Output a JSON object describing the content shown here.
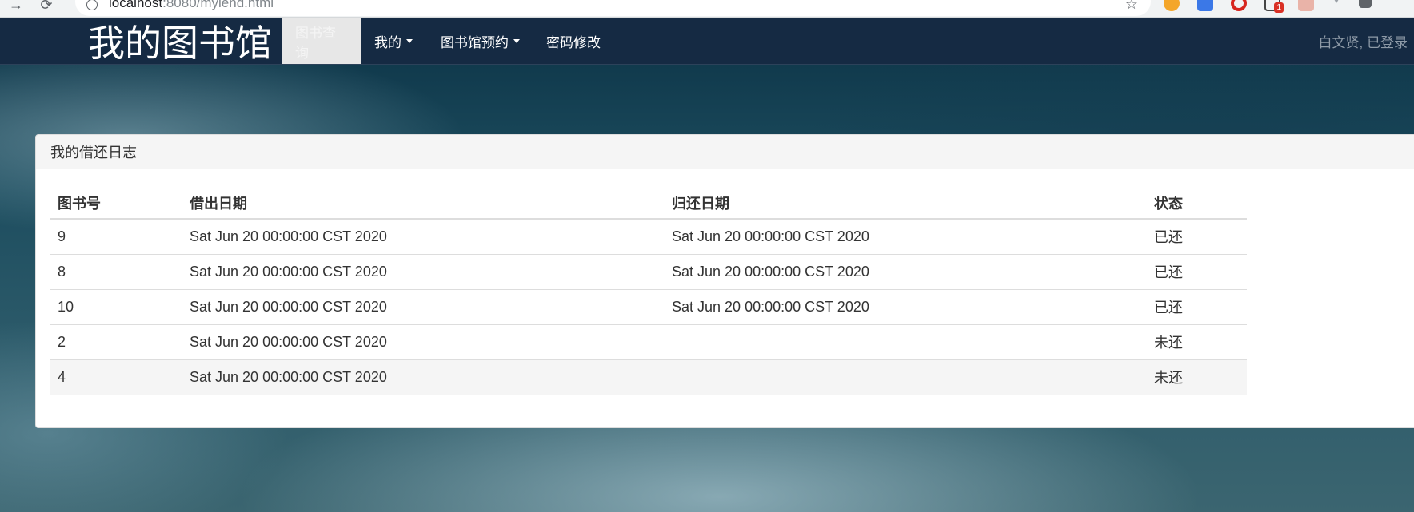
{
  "browser": {
    "url_host": "localhost",
    "url_path": ":8080/mylend.html"
  },
  "navbar": {
    "brand": "我的图书馆",
    "items": [
      {
        "label": "图书查询",
        "active": true,
        "dropdown": false
      },
      {
        "label": "我的",
        "active": false,
        "dropdown": true
      },
      {
        "label": "图书馆预约",
        "active": false,
        "dropdown": true
      },
      {
        "label": "密码修改",
        "active": false,
        "dropdown": false
      }
    ],
    "login_status": "白文贤, 已登录"
  },
  "panel": {
    "title": "我的借还日志",
    "columns": [
      "图书号",
      "借出日期",
      "归还日期",
      "状态"
    ],
    "rows": [
      {
        "book_id": "9",
        "lend_date": "Sat Jun 20 00:00:00 CST 2020",
        "return_date": "Sat Jun 20 00:00:00 CST 2020",
        "status": "已还"
      },
      {
        "book_id": "8",
        "lend_date": "Sat Jun 20 00:00:00 CST 2020",
        "return_date": "Sat Jun 20 00:00:00 CST 2020",
        "status": "已还"
      },
      {
        "book_id": "10",
        "lend_date": "Sat Jun 20 00:00:00 CST 2020",
        "return_date": "Sat Jun 20 00:00:00 CST 2020",
        "status": "已还"
      },
      {
        "book_id": "2",
        "lend_date": "Sat Jun 20 00:00:00 CST 2020",
        "return_date": "",
        "status": "未还"
      },
      {
        "book_id": "4",
        "lend_date": "Sat Jun 20 00:00:00 CST 2020",
        "return_date": "",
        "status": "未还"
      }
    ]
  },
  "colors": {
    "navbar_bg": "#152a43",
    "active_tab_bg": "#e7e7e7",
    "panel_heading_bg": "#f5f5f5",
    "text": "#333333"
  }
}
